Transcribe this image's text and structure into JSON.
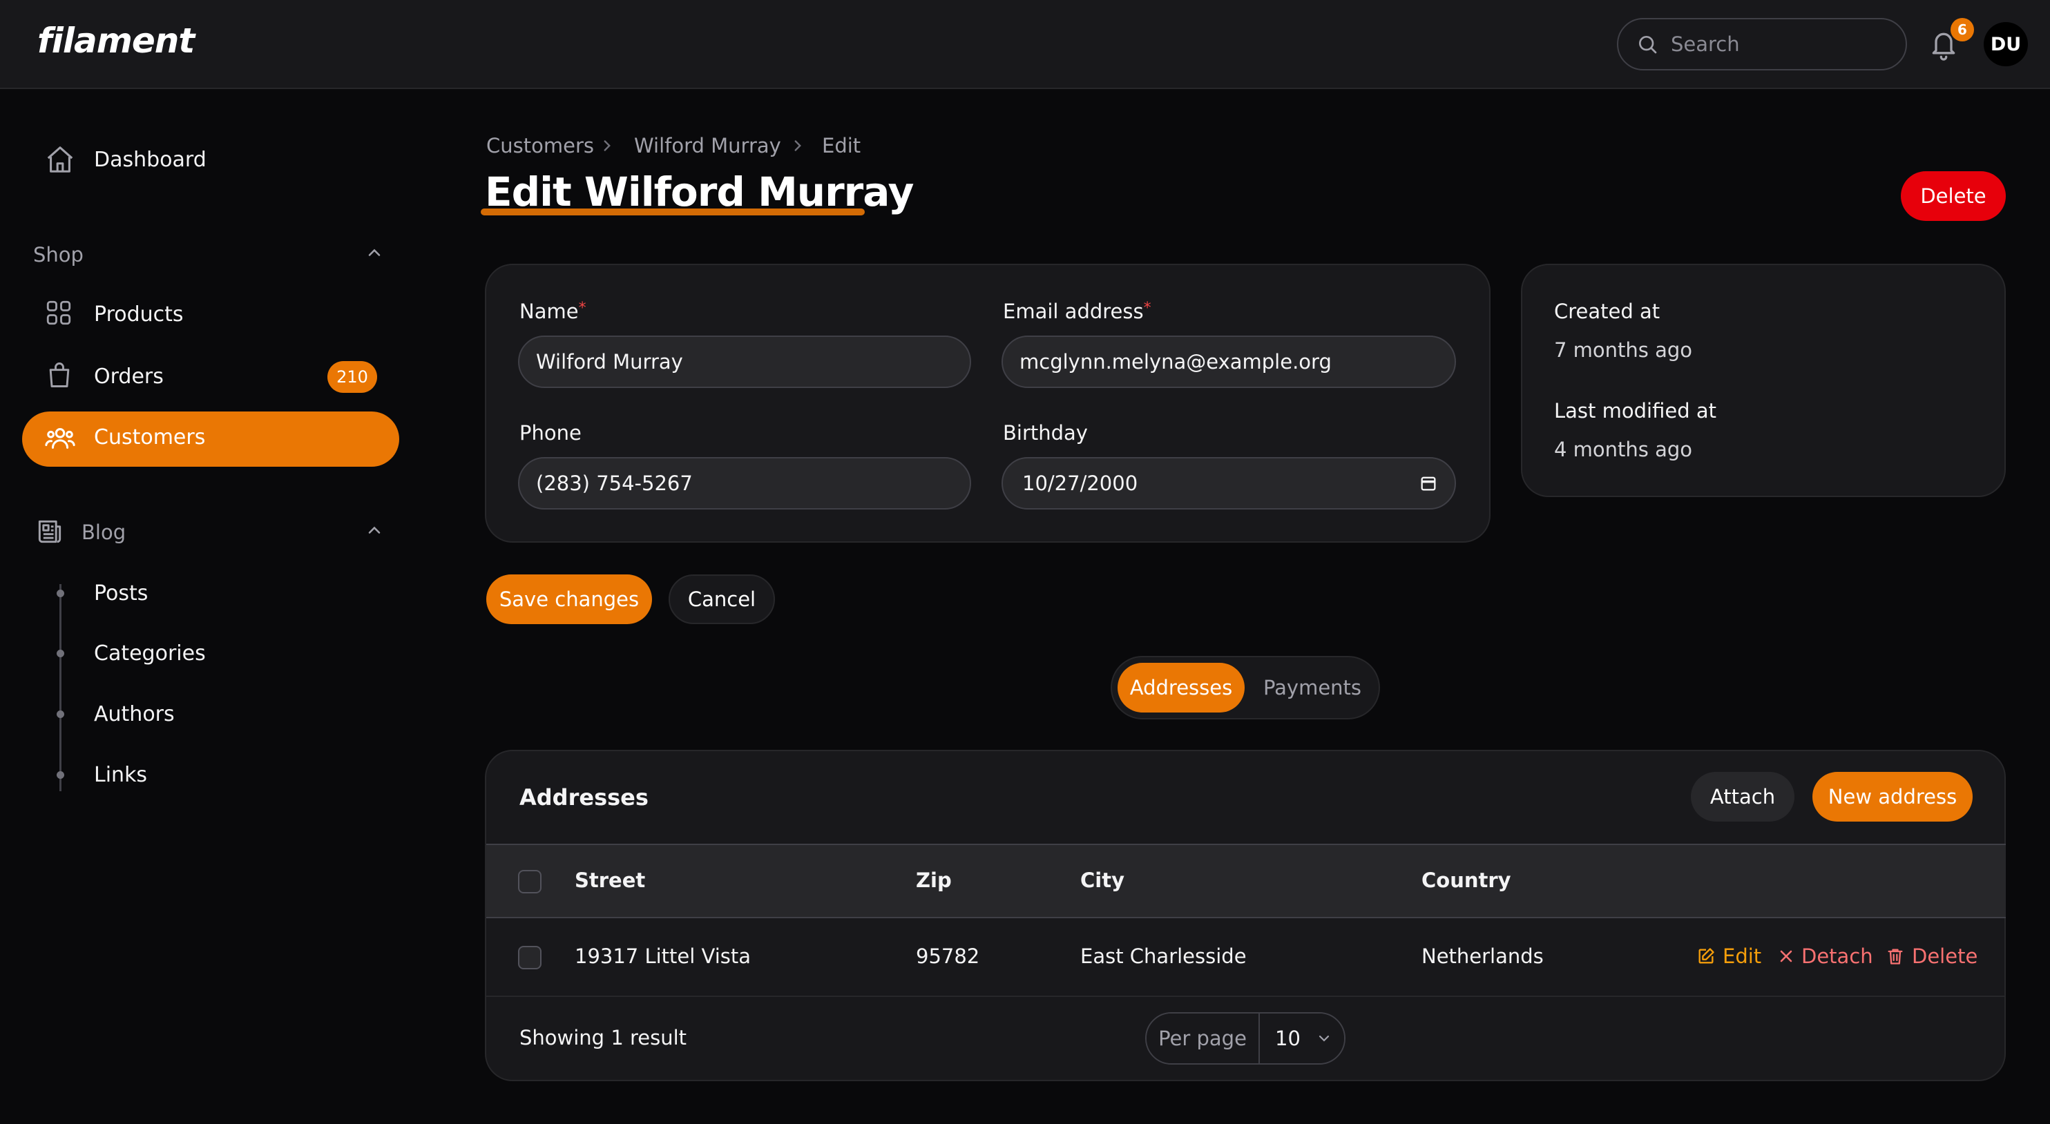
{
  "brand": {
    "logo": "filament",
    "accent": "#ea7704",
    "danger": "#e7000b"
  },
  "topbar": {
    "search_placeholder": "Search",
    "notification_count": "6",
    "avatar_initials": "DU"
  },
  "sidebar": {
    "dashboard": "Dashboard",
    "groups": [
      {
        "label": "Shop",
        "items": [
          {
            "label": "Products",
            "icon": "grid-icon"
          },
          {
            "label": "Orders",
            "icon": "shopping-bag-icon",
            "badge": "210"
          },
          {
            "label": "Customers",
            "icon": "users-icon",
            "active": true
          }
        ]
      },
      {
        "label": "Blog",
        "items": [
          {
            "label": "Posts"
          },
          {
            "label": "Categories"
          },
          {
            "label": "Authors"
          },
          {
            "label": "Links"
          }
        ]
      }
    ]
  },
  "breadcrumb": [
    "Customers",
    "Wilford Murray",
    "Edit"
  ],
  "page": {
    "title": "Edit Wilford Murray",
    "delete_label": "Delete"
  },
  "form": {
    "name": {
      "label": "Name",
      "required": "*",
      "value": "Wilford Murray"
    },
    "email": {
      "label": "Email address",
      "required": "*",
      "value": "mcglynn.melyna@example.org"
    },
    "phone": {
      "label": "Phone",
      "value": "(283) 754-5267"
    },
    "birthday": {
      "label": "Birthday",
      "value": "10/27/2000"
    },
    "save_label": "Save changes",
    "cancel_label": "Cancel"
  },
  "meta": {
    "created_label": "Created at",
    "created_value": "7 months ago",
    "modified_label": "Last modified at",
    "modified_value": "4 months ago"
  },
  "tabs": [
    "Addresses",
    "Payments"
  ],
  "addresses": {
    "heading": "Addresses",
    "attach_label": "Attach",
    "new_label": "New address",
    "columns": [
      "Street",
      "Zip",
      "City",
      "Country"
    ],
    "rows": [
      {
        "street": "19317 Littel Vista",
        "zip": "95782",
        "city": "East Charlesside",
        "country": "Netherlands"
      }
    ],
    "actions": {
      "edit": "Edit",
      "detach": "Detach",
      "delete": "Delete"
    },
    "summary": "Showing 1 result",
    "per_page_label": "Per page",
    "per_page_value": "10"
  }
}
